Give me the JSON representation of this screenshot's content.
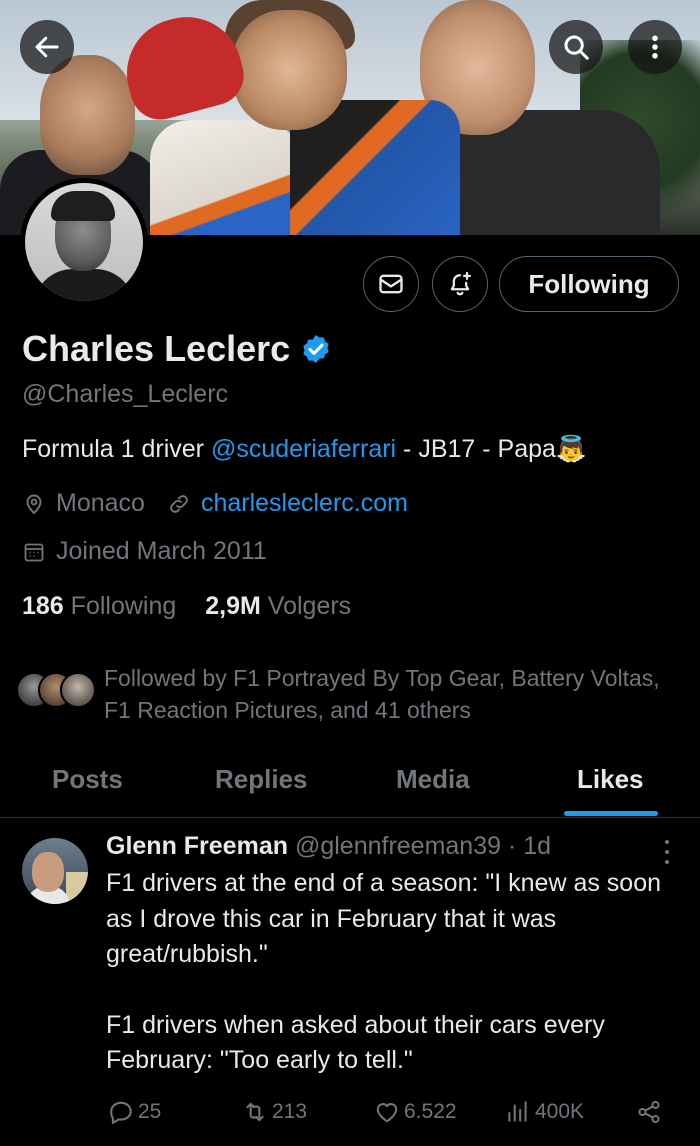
{
  "banner": {
    "description_icon_back": "arrow-left-icon",
    "search_icon": "search-icon",
    "more_icon": "more-vertical-icon"
  },
  "profile": {
    "name": "Charles Leclerc",
    "handle": "@Charles_Leclerc",
    "bio_prefix": "Formula 1 driver ",
    "bio_link": "@scuderiaferrari",
    "bio_suffix": " - JB17 - Papa",
    "bio_emoji": "👼",
    "location": "Monaco",
    "website": "charlesleclerc.com",
    "joined": "Joined March 2011",
    "following_count": "186",
    "following_label": "Following",
    "followers_count": "2,9M",
    "followers_label": "Volgers",
    "followed_by": "Followed by F1 Portrayed By Top Gear, Battery Voltas, F1 Reaction Pictures, and 41 others"
  },
  "buttons": {
    "follow_label": "Following"
  },
  "tabs": [
    {
      "label": "Posts"
    },
    {
      "label": "Replies"
    },
    {
      "label": "Media"
    },
    {
      "label": "Likes"
    }
  ],
  "post": {
    "author_name": "Glenn Freeman",
    "author_handle": "@glennfreeman39",
    "time": "· 1d",
    "paragraph1": "F1 drivers at the end of a season: \"I knew as soon as I drove this car in February that it was great/rubbish.\"",
    "paragraph2": "F1 drivers when asked about their cars every February: \"Too early to tell.\"",
    "replies": "25",
    "reposts": "213",
    "likes": "6.522",
    "views": "400K"
  },
  "colors": {
    "accent": "#1d9bf0",
    "muted": "#71767b",
    "text": "#e7e9ea",
    "background": "#000000"
  }
}
